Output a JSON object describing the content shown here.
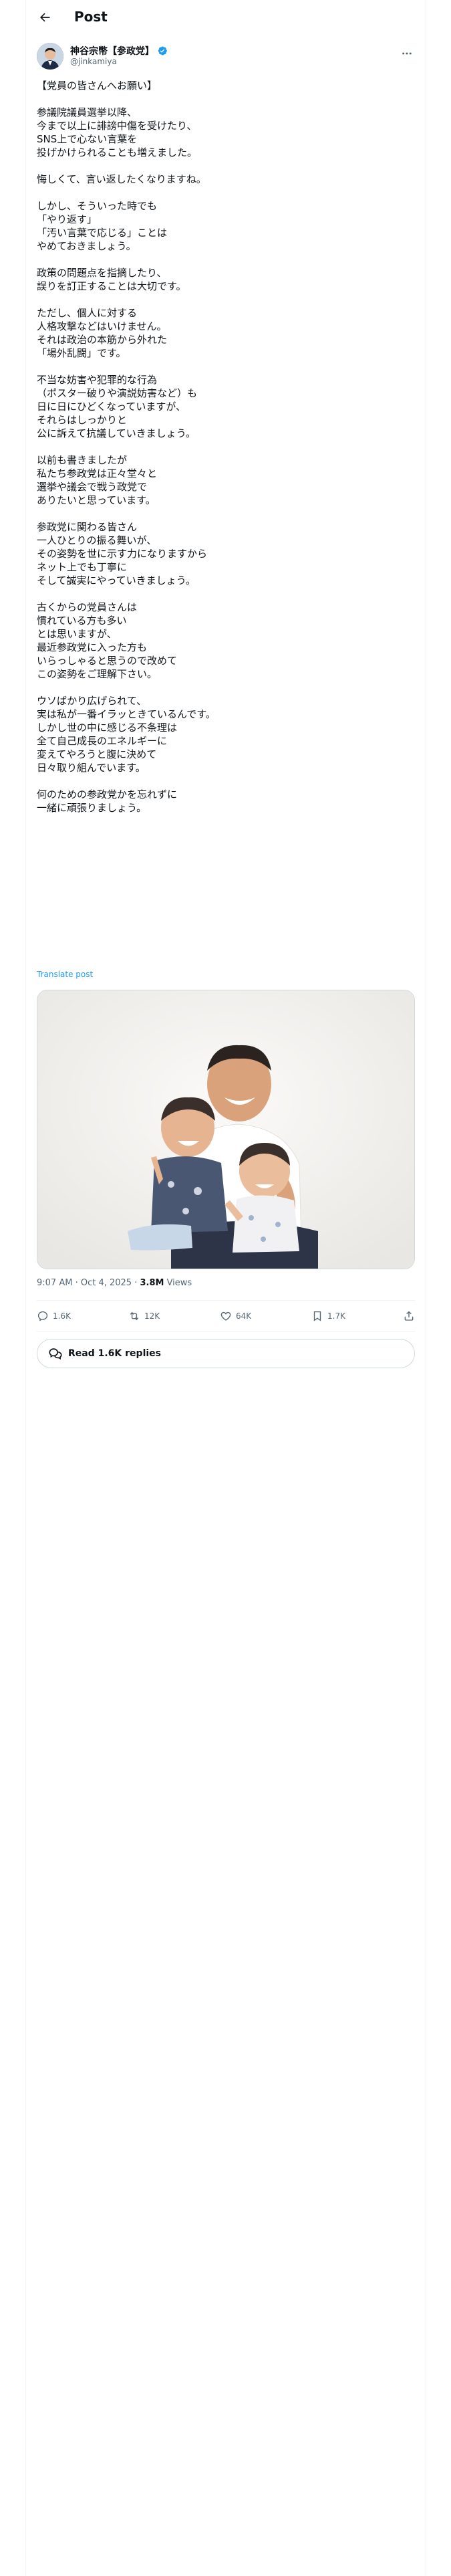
{
  "header": {
    "title": "Post"
  },
  "author": {
    "name": "神谷宗幣【参政党】",
    "handle": "@jinkamiya"
  },
  "post": {
    "paragraphs": [
      [
        "【党員の皆さんへお願い】"
      ],
      [
        "参議院議員選挙以降、",
        "今まで以上に誹謗中傷を受けたり、",
        "SNS上で心ない言葉を",
        "投げかけられることも増えました。"
      ],
      [
        "悔しくて、言い返したくなりますね。"
      ],
      [
        "しかし、そういった時でも",
        "「やり返す」",
        "「汚い言葉で応じる」ことは",
        "やめておきましょう。"
      ],
      [
        "政策の問題点を指摘したり、",
        "誤りを訂正することは大切です。"
      ],
      [
        "ただし、個人に対する",
        "人格攻撃などはいけません。",
        "それは政治の本筋から外れた",
        "「場外乱闘」です。"
      ],
      [
        "不当な妨害や犯罪的な行為",
        "（ポスター破りや演説妨害など）も",
        "日に日にひどくなっていますが、",
        "それらはしっかりと",
        "公に訴えて抗議していきましょう。"
      ],
      [
        "以前も書きましたが",
        "私たち参政党は正々堂々と",
        "選挙や議会で戦う政党で",
        "ありたいと思っています。"
      ],
      [
        "参政党に関わる皆さん",
        "一人ひとりの振る舞いが、",
        "その姿勢を世に示す力になりますから",
        "ネット上でも丁寧に",
        "そして誠実にやっていきましょう。"
      ],
      [
        "古くからの党員さんは",
        "慣れている方も多い",
        "とは思いますが、",
        "最近参政党に入った方も",
        "いらっしゃると思うので改めて",
        "この姿勢をご理解下さい。"
      ],
      [
        "ウソばかり広げられて、",
        "実は私が一番イラッときているんです。",
        "しかし世の中に感じる不条理は",
        "全て自己成長のエネルギーに",
        "変えてやろうと腹に決めて",
        "日々取り組んでいます。"
      ],
      [
        "何のための参政党かを忘れずに",
        "一緒に頑張りましょう。"
      ]
    ],
    "translate_label": "Translate post",
    "timestamp": "9:07 AM · Oct 4, 2025",
    "separator": " · ",
    "views_count": "3.8M",
    "views_label": " Views"
  },
  "actions": {
    "replies": "1.6K",
    "reposts": "12K",
    "likes": "64K",
    "bookmarks": "1.7K"
  },
  "read_replies_label": "Read 1.6K replies",
  "colors": {
    "accent": "#1d9bf0",
    "text": "#0f1419",
    "muted": "#536471",
    "border": "#eff3f4"
  }
}
